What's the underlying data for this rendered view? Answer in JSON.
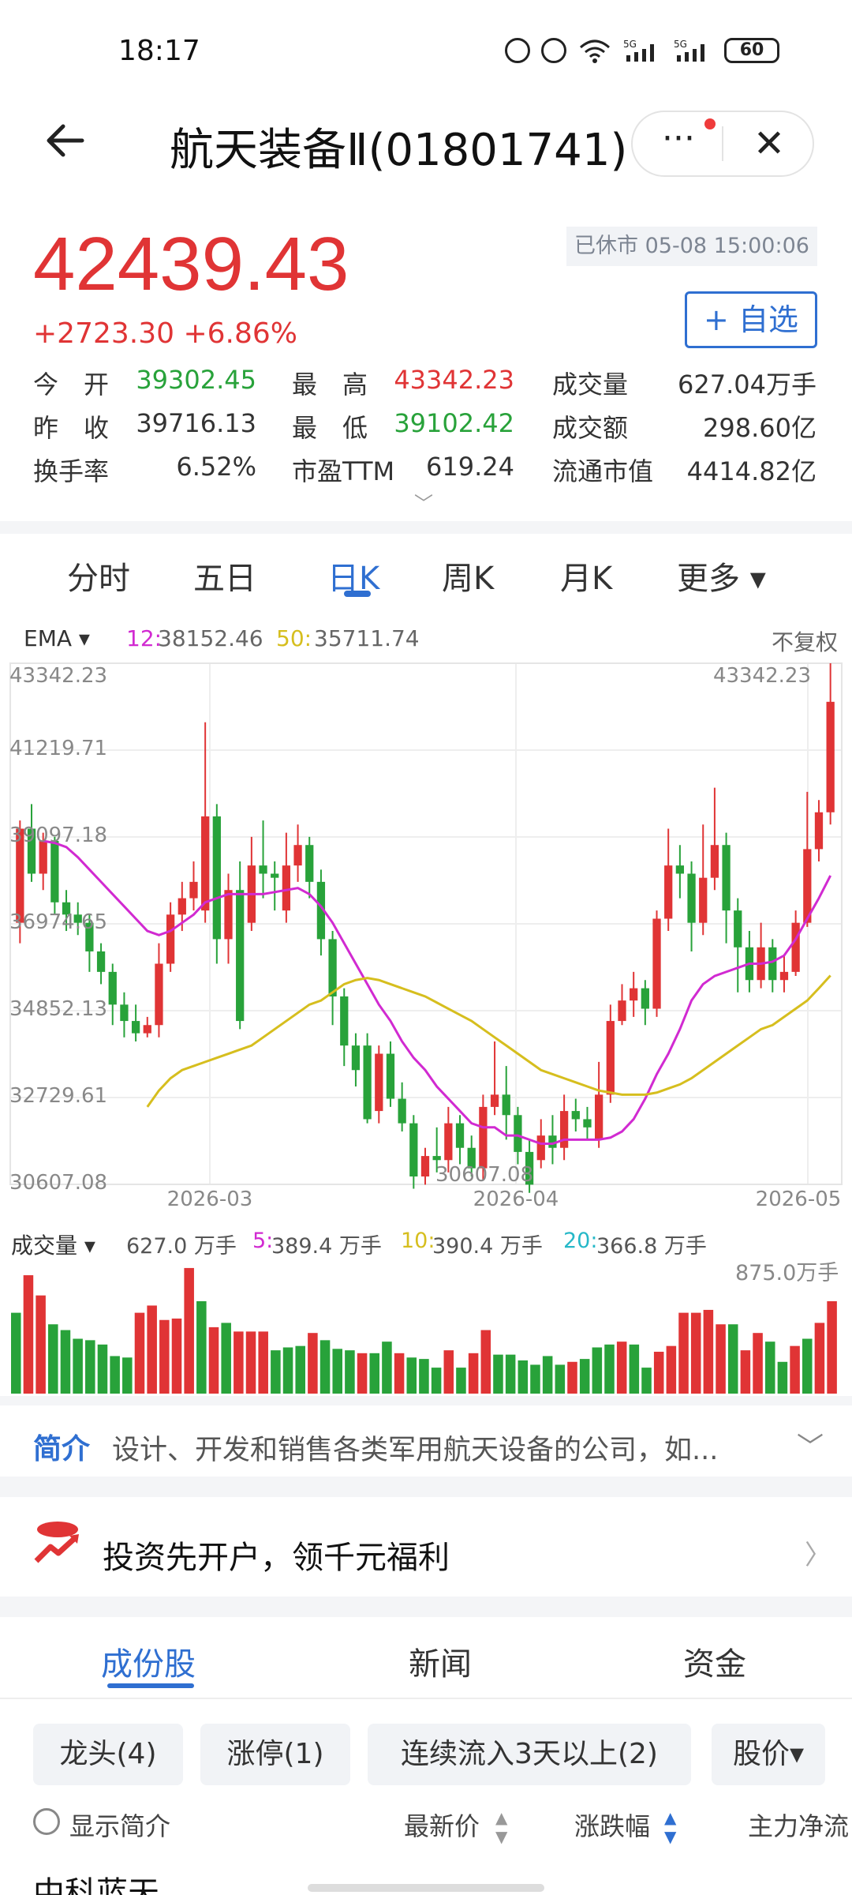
{
  "status": {
    "time": "18:17",
    "battery": "60"
  },
  "header": {
    "title": "航天装备Ⅱ(01801741)",
    "more": "···",
    "close": "✕"
  },
  "quote": {
    "price": "42439.43",
    "change": "+2723.30  +6.86%",
    "time_badge": "已休市 05-08 15:00:06",
    "watch_button": "+ 自选",
    "rows": [
      [
        {
          "k": "今　开",
          "v": "39302.45",
          "c": "green"
        },
        {
          "k": "最　高",
          "v": "43342.23",
          "c": "red"
        },
        {
          "k": "成交量",
          "v": "627.04万手",
          "c": "dark"
        }
      ],
      [
        {
          "k": "昨　收",
          "v": "39716.13",
          "c": "dark"
        },
        {
          "k": "最　低",
          "v": "39102.42",
          "c": "green"
        },
        {
          "k": "成交额",
          "v": "298.60亿",
          "c": "dark"
        }
      ],
      [
        {
          "k": "换手率",
          "v": "6.52%",
          "c": "dark"
        },
        {
          "k": "市盈TTM",
          "v": "619.24",
          "c": "dark"
        },
        {
          "k": "流通市值",
          "v": "4414.82亿",
          "c": "dark"
        }
      ]
    ]
  },
  "ktabs": [
    "分时",
    "五日",
    "日K",
    "周K",
    "月K",
    "更多 ▾"
  ],
  "ktab_active": 2,
  "ema": {
    "label": "EMA ▾",
    "s1_name": "12:",
    "s1_val": "38152.46",
    "s2_name": "50:",
    "s2_val": "35711.74",
    "fq": "不复权"
  },
  "colors": {
    "up": "#e03435",
    "down": "#28a23a",
    "ema12": "#d12ad1",
    "ema50": "#d6be1e",
    "accent": "#2f6fd1"
  },
  "chart_data": {
    "type": "candlestick",
    "y_ticks": [
      "43342.23",
      "41219.71",
      "39097.18",
      "36974.65",
      "34852.13",
      "32729.61",
      "30607.08"
    ],
    "ylim": [
      30607.08,
      43342.23
    ],
    "x_ticks": [
      "2026-03",
      "2026-04",
      "2026-05"
    ],
    "max_label": "43342.23",
    "min_label": "30607.08",
    "candles": [
      [
        37000,
        39300,
        36500,
        39500
      ],
      [
        39300,
        38200,
        38000,
        39900
      ],
      [
        38200,
        39000,
        37800,
        39200
      ],
      [
        39000,
        37500,
        37200,
        39100
      ],
      [
        37500,
        37200,
        36800,
        37800
      ],
      [
        37200,
        37000,
        36700,
        37500
      ],
      [
        37000,
        36300,
        35800,
        37200
      ],
      [
        36300,
        35800,
        35500,
        36500
      ],
      [
        35800,
        35000,
        34500,
        36000
      ],
      [
        35000,
        34600,
        34200,
        35300
      ],
      [
        34600,
        34300,
        34100,
        35000
      ],
      [
        34300,
        34500,
        34200,
        34700
      ],
      [
        34500,
        36000,
        34200,
        36500
      ],
      [
        36000,
        37200,
        35800,
        37500
      ],
      [
        37200,
        37600,
        36800,
        38000
      ],
      [
        37600,
        38000,
        37300,
        38500
      ],
      [
        37300,
        39600,
        37000,
        41900
      ],
      [
        39600,
        36600,
        36000,
        39900
      ],
      [
        36600,
        37800,
        36000,
        38200
      ],
      [
        37800,
        34600,
        34400,
        38500
      ],
      [
        37000,
        38400,
        36800,
        39100
      ],
      [
        38400,
        38200,
        37600,
        39500
      ],
      [
        38200,
        38100,
        37300,
        38500
      ],
      [
        37300,
        38400,
        37000,
        39200
      ],
      [
        38400,
        38900,
        38000,
        39400
      ],
      [
        38900,
        38000,
        37600,
        39100
      ],
      [
        38000,
        36600,
        36200,
        38300
      ],
      [
        36600,
        35200,
        34500,
        36800
      ],
      [
        35200,
        34000,
        33500,
        35400
      ],
      [
        34000,
        33400,
        33000,
        34300
      ],
      [
        34000,
        32200,
        32100,
        34300
      ],
      [
        32400,
        33800,
        32100,
        34000
      ],
      [
        33800,
        32700,
        32500,
        34100
      ],
      [
        32700,
        32100,
        31900,
        33100
      ],
      [
        32100,
        30800,
        30500,
        32300
      ],
      [
        30800,
        31300,
        30600,
        31500
      ],
      [
        31300,
        31200,
        30900,
        32000
      ],
      [
        31200,
        32100,
        30900,
        32500
      ],
      [
        32100,
        31500,
        31100,
        32300
      ],
      [
        31500,
        31000,
        30800,
        31800
      ],
      [
        31000,
        32500,
        30700,
        32800
      ],
      [
        32500,
        32800,
        32300,
        34100
      ],
      [
        32800,
        32300,
        31700,
        33500
      ],
      [
        32300,
        31400,
        31100,
        32500
      ],
      [
        31400,
        30600,
        30400,
        31700
      ],
      [
        31200,
        31800,
        31000,
        32200
      ],
      [
        31800,
        31500,
        31100,
        32300
      ],
      [
        31500,
        32400,
        31200,
        32800
      ],
      [
        32400,
        32200,
        31900,
        32700
      ],
      [
        32200,
        32000,
        31700,
        32500
      ],
      [
        31700,
        32800,
        31500,
        33600
      ],
      [
        32800,
        34600,
        32600,
        35000
      ],
      [
        34600,
        35100,
        34500,
        35500
      ],
      [
        35100,
        35400,
        34700,
        35800
      ],
      [
        35400,
        34900,
        34500,
        35600
      ],
      [
        34900,
        37100,
        34700,
        37300
      ],
      [
        37100,
        38400,
        36800,
        39300
      ],
      [
        38400,
        38200,
        37600,
        38900
      ],
      [
        38200,
        37000,
        36300,
        38500
      ],
      [
        37000,
        38100,
        36700,
        39400
      ],
      [
        38100,
        38900,
        37800,
        40300
      ],
      [
        38900,
        37300,
        36500,
        39200
      ],
      [
        37300,
        36400,
        35300,
        37600
      ],
      [
        36400,
        35600,
        35300,
        36800
      ],
      [
        35600,
        36400,
        35400,
        37000
      ],
      [
        36400,
        35600,
        35300,
        36600
      ],
      [
        35600,
        35800,
        35300,
        36200
      ],
      [
        35800,
        37000,
        35700,
        37300
      ],
      [
        37000,
        38800,
        36900,
        40200
      ],
      [
        38800,
        39700,
        38500,
        40000
      ],
      [
        39700,
        42400,
        39400,
        43342
      ]
    ],
    "ema12": [
      39000,
      38950,
      38850,
      38600,
      38300,
      38000,
      37700,
      37400,
      37100,
      36800,
      36700,
      36800,
      37000,
      37200,
      37500,
      37600,
      37700,
      37700,
      37700,
      37700,
      37750,
      37800,
      37850,
      37700,
      37400,
      37000,
      36500,
      36000,
      35500,
      35000,
      34600,
      34100,
      33700,
      33400,
      33000,
      32700,
      32400,
      32100,
      32000,
      32000,
      31800,
      31800,
      31700,
      31600,
      31600,
      31700,
      31700,
      31700,
      31700,
      31750,
      31900,
      32200,
      32700,
      33300,
      33800,
      34400,
      35100,
      35500,
      35700,
      35800,
      35900,
      36000,
      36000,
      36050,
      36200,
      36600,
      37100,
      37600,
      38152.46
    ],
    "ema50": [
      32500,
      32900,
      33200,
      33400,
      33500,
      33600,
      33700,
      33800,
      33900,
      34000,
      34200,
      34400,
      34600,
      34800,
      35000,
      35100,
      35300,
      35500,
      35600,
      35650,
      35600,
      35500,
      35400,
      35300,
      35200,
      35050,
      34900,
      34750,
      34600,
      34400,
      34200,
      34000,
      33800,
      33600,
      33400,
      33300,
      33200,
      33100,
      33000,
      32900,
      32850,
      32800,
      32800,
      32800,
      32850,
      32950,
      33050,
      33200,
      33400,
      33600,
      33800,
      34000,
      34200,
      34400,
      34500,
      34700,
      34900,
      35100,
      35400,
      35711.74
    ]
  },
  "vol": {
    "label": "成交量 ▾",
    "total": "627.0 万手",
    "l5": "5:",
    "v5": "389.4 万手",
    "l10": "10:",
    "v10": "390.4 万手",
    "l20": "20:",
    "v20": "366.8 万手",
    "max_label": "875.0万手",
    "bars": [
      [
        560,
        "d"
      ],
      [
        820,
        "u"
      ],
      [
        680,
        "u"
      ],
      [
        480,
        "d"
      ],
      [
        440,
        "d"
      ],
      [
        380,
        "d"
      ],
      [
        370,
        "d"
      ],
      [
        340,
        "d"
      ],
      [
        260,
        "d"
      ],
      [
        250,
        "d"
      ],
      [
        560,
        "u"
      ],
      [
        610,
        "u"
      ],
      [
        510,
        "u"
      ],
      [
        520,
        "u"
      ],
      [
        870,
        "u"
      ],
      [
        640,
        "d"
      ],
      [
        460,
        "u"
      ],
      [
        490,
        "d"
      ],
      [
        430,
        "u"
      ],
      [
        430,
        "u"
      ],
      [
        430,
        "u"
      ],
      [
        300,
        "d"
      ],
      [
        320,
        "d"
      ],
      [
        330,
        "d"
      ],
      [
        420,
        "u"
      ],
      [
        370,
        "d"
      ],
      [
        310,
        "d"
      ],
      [
        300,
        "d"
      ],
      [
        280,
        "u"
      ],
      [
        280,
        "d"
      ],
      [
        360,
        "d"
      ],
      [
        280,
        "u"
      ],
      [
        250,
        "d"
      ],
      [
        240,
        "d"
      ],
      [
        180,
        "d"
      ],
      [
        300,
        "u"
      ],
      [
        180,
        "d"
      ],
      [
        280,
        "u"
      ],
      [
        440,
        "u"
      ],
      [
        270,
        "d"
      ],
      [
        270,
        "d"
      ],
      [
        230,
        "d"
      ],
      [
        200,
        "d"
      ],
      [
        260,
        "d"
      ],
      [
        200,
        "d"
      ],
      [
        220,
        "u"
      ],
      [
        240,
        "d"
      ],
      [
        320,
        "d"
      ],
      [
        340,
        "d"
      ],
      [
        360,
        "u"
      ],
      [
        340,
        "d"
      ],
      [
        180,
        "d"
      ],
      [
        290,
        "u"
      ],
      [
        330,
        "u"
      ],
      [
        560,
        "u"
      ],
      [
        560,
        "u"
      ],
      [
        580,
        "u"
      ],
      [
        480,
        "u"
      ],
      [
        480,
        "d"
      ],
      [
        300,
        "u"
      ],
      [
        420,
        "u"
      ],
      [
        360,
        "d"
      ],
      [
        220,
        "d"
      ],
      [
        330,
        "u"
      ],
      [
        380,
        "d"
      ],
      [
        490,
        "u"
      ],
      [
        640,
        "u"
      ]
    ]
  },
  "intro": {
    "tag": "简介",
    "text": "设计、开发和销售各类军用航天设备的公司，如...",
    "chevron": "﹀"
  },
  "ad": {
    "text": "投资先开户，领千元福利",
    "chevron": "〉"
  },
  "btabs": [
    "成份股",
    "新闻",
    "资金"
  ],
  "chips": [
    "龙头(4)",
    "涨停(1)",
    "连续流入3天以上(2)",
    "股价▾"
  ],
  "table": {
    "show_intro": "显示简介",
    "col1": "最新价",
    "col2": "涨跌幅",
    "col3": "主力净流",
    "first_row": "中科蓝天"
  }
}
